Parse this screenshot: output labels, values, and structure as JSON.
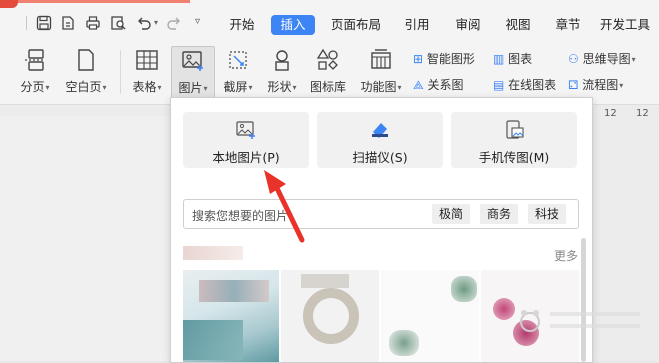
{
  "tabs": [
    {
      "label": "开始",
      "active": false
    },
    {
      "label": "插入",
      "active": true
    },
    {
      "label": "页面布局",
      "active": false
    },
    {
      "label": "引用",
      "active": false
    },
    {
      "label": "审阅",
      "active": false
    },
    {
      "label": "视图",
      "active": false
    },
    {
      "label": "章节",
      "active": false
    },
    {
      "label": "开发工具",
      "active": false
    }
  ],
  "ribbon": {
    "page_break": "分页",
    "blank_page": "空白页",
    "table": "表格",
    "picture": "图片",
    "screenshot": "截屏",
    "shape": "形状",
    "icon_library": "图标库",
    "function_chart": "功能图",
    "smart_shape": "智能图形",
    "relation_chart": "关系图",
    "chart": "图表",
    "online_chart": "在线图表",
    "mind_map": "思维导图",
    "flowchart": "流程图"
  },
  "ruler": {
    "n12a": "12",
    "n12b": "12"
  },
  "popup": {
    "local_picture": "本地图片(P)",
    "scanner": "扫描仪(S)",
    "phone_transfer": "手机传图(M)",
    "search_placeholder": "搜索您想要的图片",
    "tags": [
      "极简",
      "商务",
      "科技"
    ],
    "more": "更多"
  },
  "colors": {
    "accent": "#3d84f5",
    "arrow": "#e8322a"
  }
}
